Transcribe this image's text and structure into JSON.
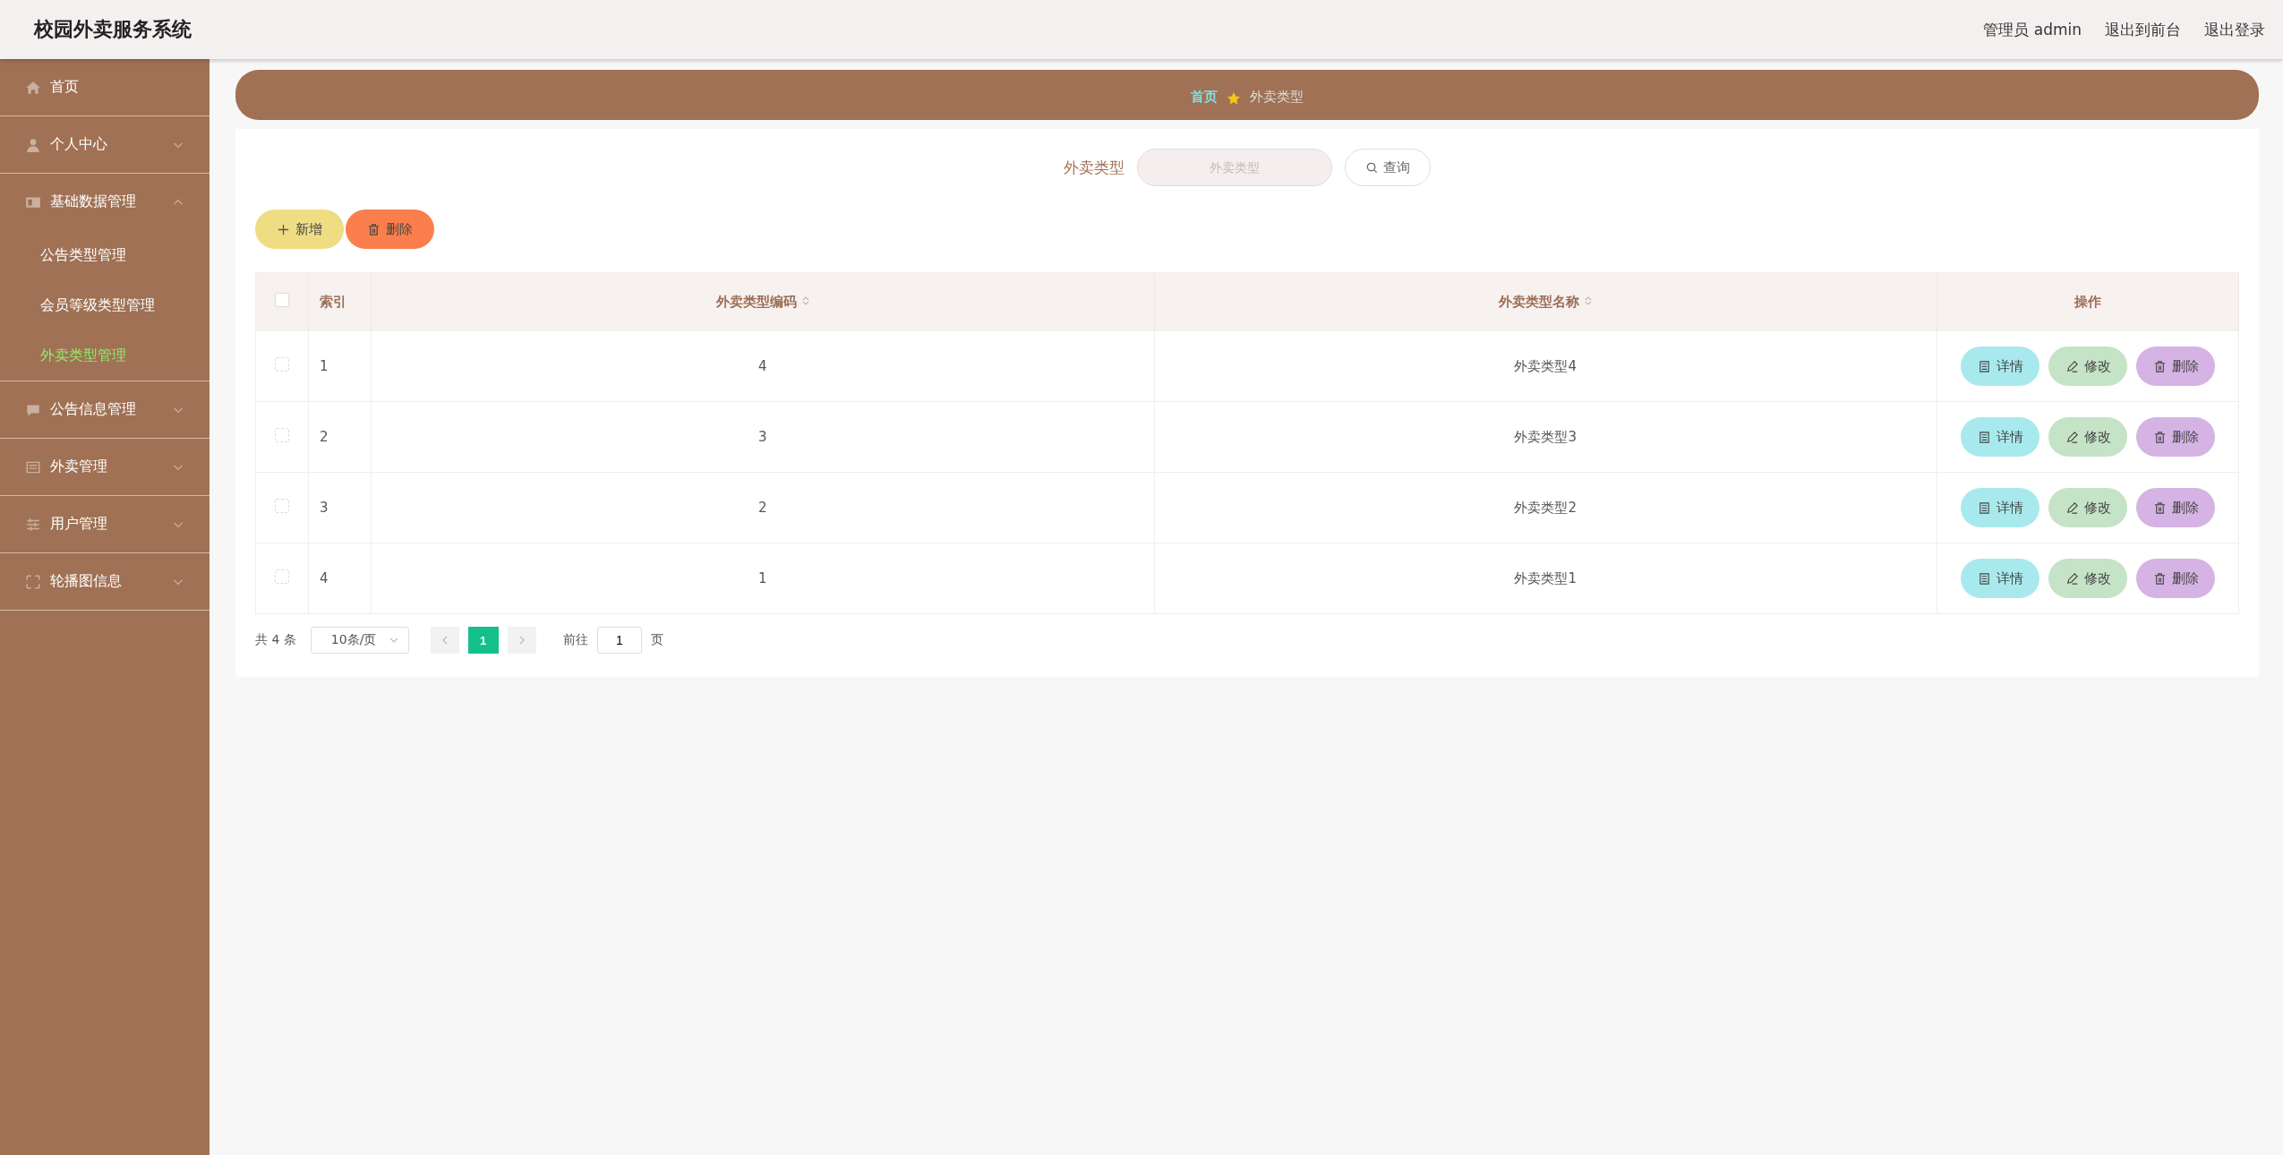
{
  "header": {
    "title": "校园外卖服务系统",
    "user": "管理员 admin",
    "links": [
      "退出到前台",
      "退出登录"
    ]
  },
  "sidebar": {
    "items": [
      {
        "label": "首页",
        "kind": "link"
      },
      {
        "label": "个人中心",
        "kind": "menu",
        "expanded": false
      },
      {
        "label": "基础数据管理",
        "kind": "menu",
        "expanded": true,
        "children": [
          {
            "label": "公告类型管理",
            "selected": false
          },
          {
            "label": "会员等级类型管理",
            "selected": false
          },
          {
            "label": "外卖类型管理",
            "selected": true
          }
        ]
      },
      {
        "label": "公告信息管理",
        "kind": "menu",
        "expanded": false
      },
      {
        "label": "外卖管理",
        "kind": "menu",
        "expanded": false
      },
      {
        "label": "用户管理",
        "kind": "menu",
        "expanded": false
      },
      {
        "label": "轮播图信息",
        "kind": "menu",
        "expanded": false
      }
    ]
  },
  "breadcrumb": [
    "首页",
    "外卖类型"
  ],
  "search": {
    "label": "外卖类型",
    "placeholder": "外卖类型",
    "button": "查询"
  },
  "actions": [
    "新增",
    "删除"
  ],
  "table": {
    "all_checked": false,
    "columns": [
      "索引",
      "外卖类型编码",
      "外卖类型名称",
      "操作"
    ],
    "rows": [
      {
        "index": "1",
        "code": "4",
        "name": "外卖类型4",
        "checked": false,
        "buttons": [
          "详情",
          "修改",
          "删除"
        ]
      },
      {
        "index": "2",
        "code": "3",
        "name": "外卖类型3",
        "checked": false,
        "buttons": [
          "详情",
          "修改",
          "删除"
        ]
      },
      {
        "index": "3",
        "code": "2",
        "name": "外卖类型2",
        "checked": false,
        "buttons": [
          "详情",
          "修改",
          "删除"
        ]
      },
      {
        "index": "4",
        "code": "1",
        "name": "外卖类型1",
        "checked": false,
        "buttons": [
          "详情",
          "修改",
          "删除"
        ]
      }
    ]
  },
  "pagination": {
    "total": "共 4 条",
    "page_size": "10条/页",
    "pages": [
      {
        "label": "1",
        "selected": true
      }
    ],
    "goto_label": "前往",
    "goto_value": "1",
    "goto_suffix": "页"
  }
}
